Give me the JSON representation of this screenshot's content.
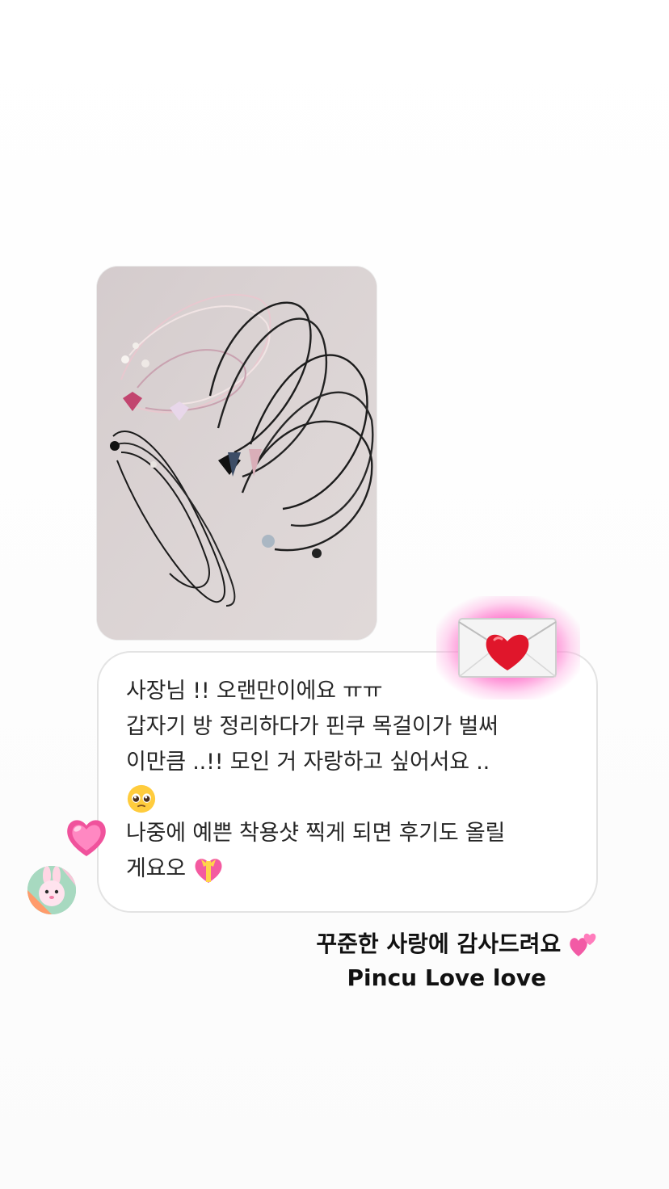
{
  "message": {
    "photo": {
      "alt": "necklaces-photo"
    },
    "text_lines": [
      "사장님 !! 오랜만이에요 ㅠㅠ",
      "갑자기 방 정리하다가 핀쿠 목걸이가 벌써",
      "이만큼 ..!! 모인 거 자랑하고 싶어서요 ..",
      "",
      "나중에 예쁜 착용샷 찍게 되면 후기도 올릴",
      "게요오"
    ],
    "emojis": {
      "pleading": "pleading-face-icon",
      "gift_heart": "heart-with-ribbon-icon"
    }
  },
  "reactions": {
    "sticker": "love-letter-icon",
    "heart": "pink-heart-icon"
  },
  "sender": {
    "avatar": "bunny-avatar"
  },
  "caption": {
    "line1": "꾸준한 사랑에 감사드려요",
    "line1_emoji": "two-hearts-icon",
    "line2": "Pincu Love love"
  },
  "colors": {
    "bubble_border": "#e3e3e3",
    "photo_bg": "#d9d2d3",
    "glow_pink": "#ff6ec8",
    "heart_red": "#e0162b"
  }
}
